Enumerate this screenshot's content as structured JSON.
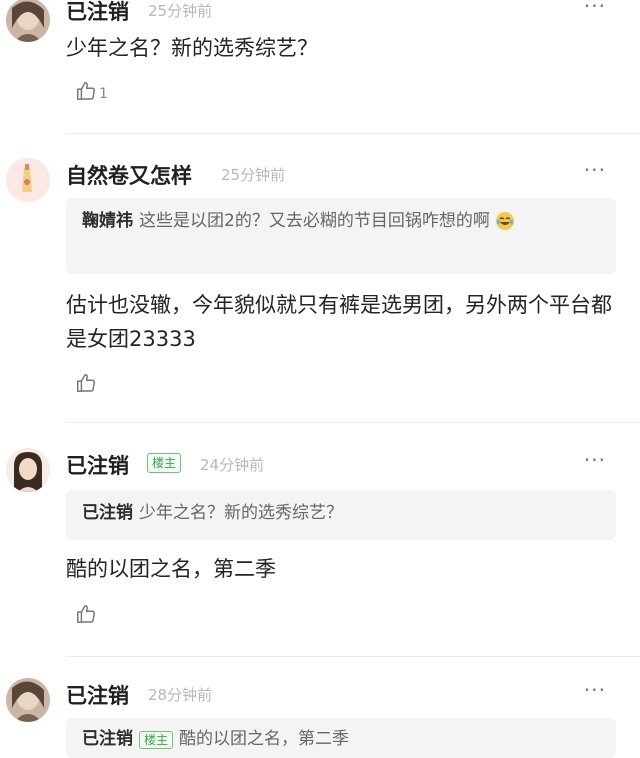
{
  "comments": [
    {
      "username": "已注销",
      "time": "25分钟前",
      "more": "···",
      "text": "少年之名？新的选秀综艺？",
      "like_count": "1"
    },
    {
      "username": "自然卷又怎样",
      "time": "25分钟前",
      "more": "···",
      "quote_name": "鞠婧祎",
      "quote_text": "这些是以团2的？又去必糊的节目回锅咋想的啊",
      "text": "估计也没辙，今年貌似就只有裤是选男团，另外两个平台都是女团23333"
    },
    {
      "username": "已注销",
      "badge": "楼主",
      "time": "24分钟前",
      "more": "···",
      "quote_name": "已注销",
      "quote_text": "少年之名？新的选秀综艺？",
      "text": "酷的以团之名，第二季"
    },
    {
      "username": "已注销",
      "time": "28分钟前",
      "more": "···",
      "quote_name": "已注销",
      "quote_badge": "楼主",
      "quote_text": "酷的以团之名，第二季"
    }
  ],
  "icons": {
    "like": "thumbs-up-outline-icon",
    "more": "more-dots-icon",
    "emoji": "laughing-tears-emoji-icon"
  },
  "colors": {
    "badge_green": "#3aa64a",
    "meta_gray": "#b8b8b8",
    "quote_bg": "#f4f4f5"
  }
}
